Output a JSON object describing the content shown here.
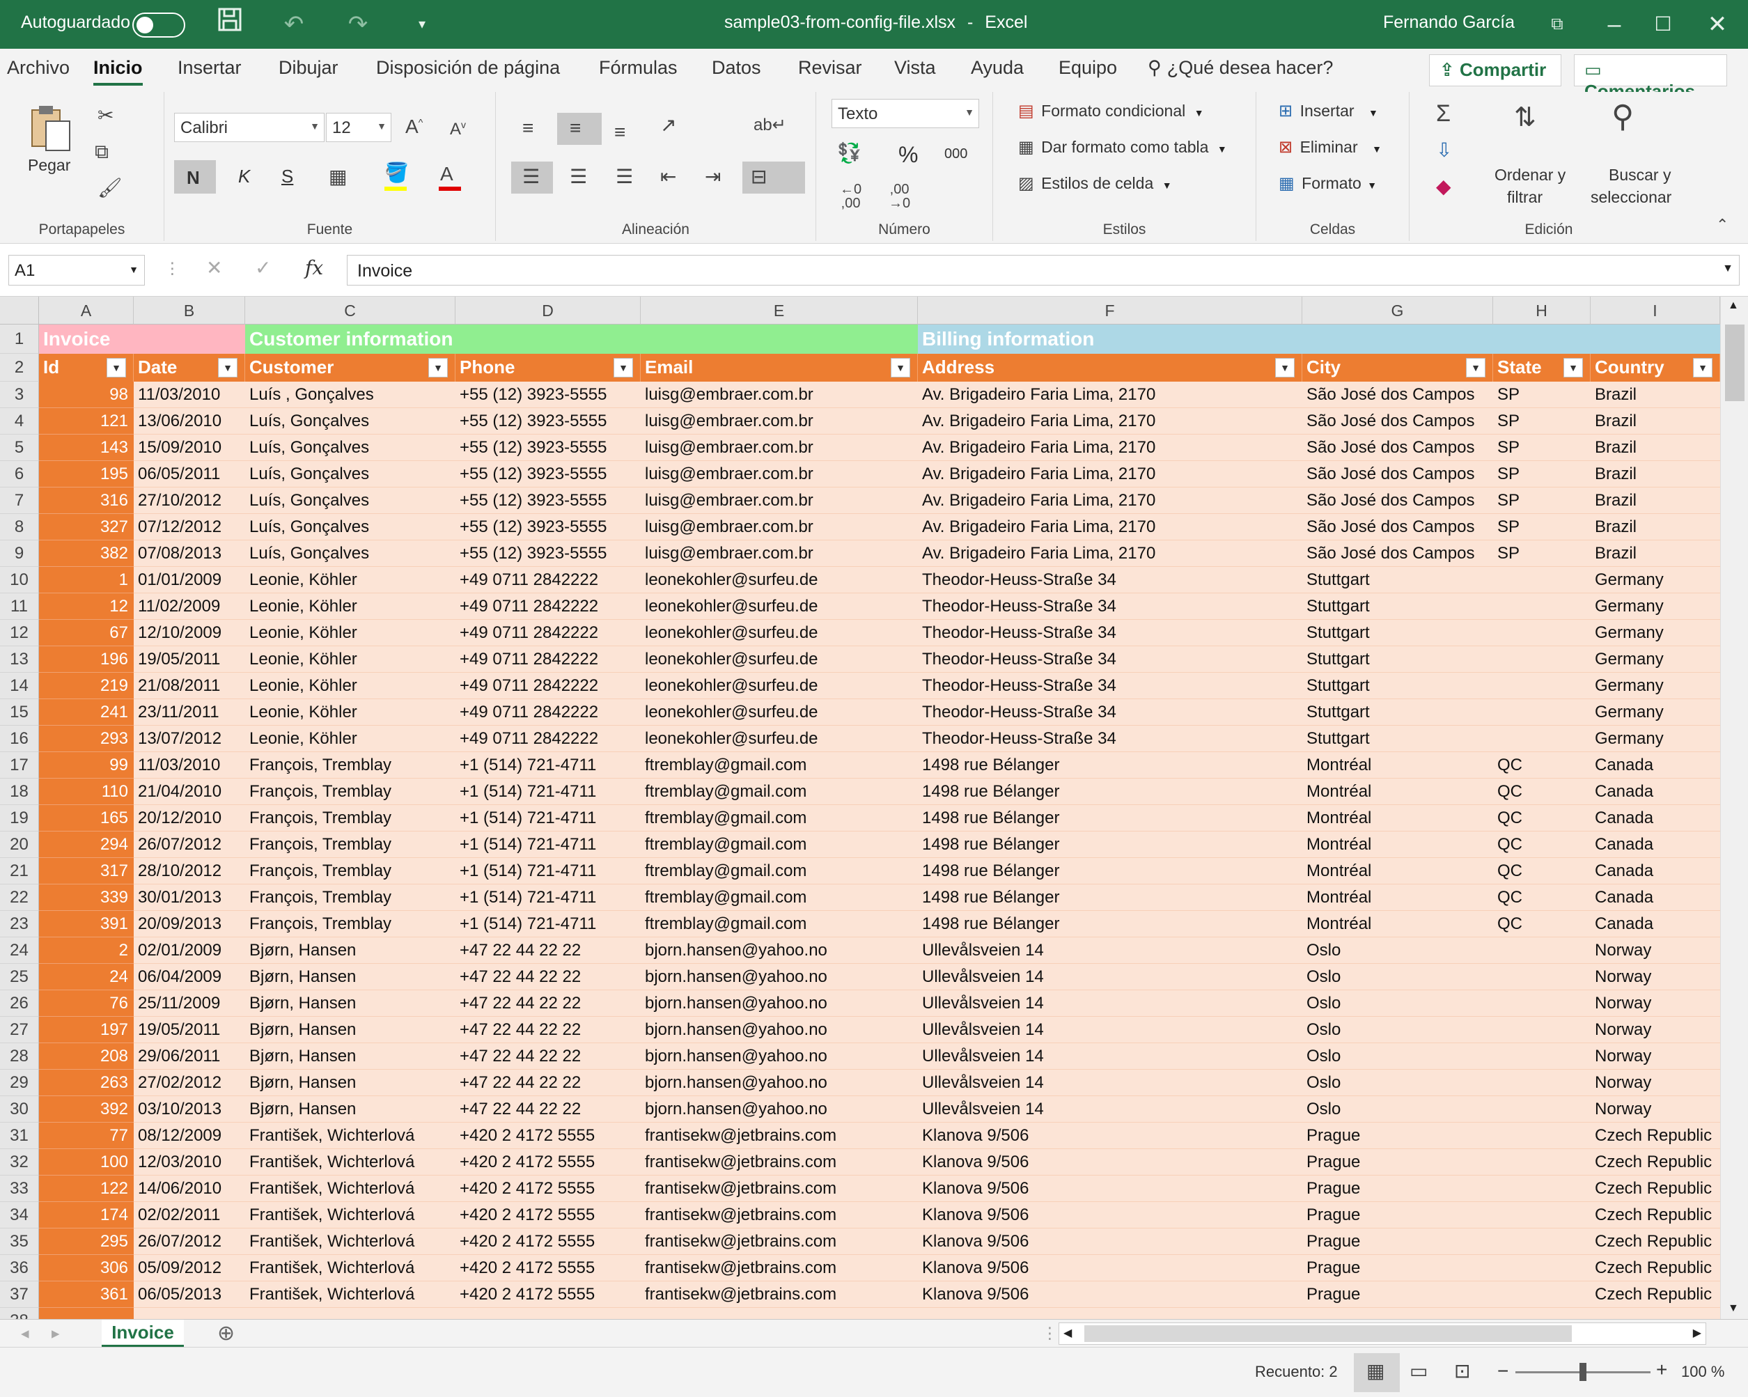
{
  "titlebar": {
    "autosave_label": "Autoguardado",
    "filename": "sample03-from-config-file.xlsx",
    "app_sep": "-",
    "app_name": "Excel",
    "user": "Fernando García"
  },
  "menu": {
    "tabs": [
      "Archivo",
      "Inicio",
      "Insertar",
      "Dibujar",
      "Disposición de página",
      "Fórmulas",
      "Datos",
      "Revisar",
      "Vista",
      "Ayuda",
      "Equipo"
    ],
    "active_tab": "Inicio",
    "tell_me": "¿Qué desea hacer?",
    "share": "Compartir",
    "comments": "Comentarios"
  },
  "ribbon": {
    "clipboard": {
      "paste": "Pegar",
      "label": "Portapapeles"
    },
    "font": {
      "family": "Calibri",
      "size": "12",
      "bold": "N",
      "italic": "K",
      "underline": "S",
      "label": "Fuente"
    },
    "alignment": {
      "label": "Alineación"
    },
    "number": {
      "format": "Texto",
      "percent": "%",
      "thousands": "000",
      "label": "Número"
    },
    "styles": {
      "conditional": "Formato condicional",
      "as_table": "Dar formato como tabla",
      "cell_styles": "Estilos de celda",
      "label": "Estilos"
    },
    "cells": {
      "insert": "Insertar",
      "delete": "Eliminar",
      "format": "Formato",
      "label": "Celdas"
    },
    "editing": {
      "sort_l1": "Ordenar y",
      "sort_l2": "filtrar",
      "find_l1": "Buscar y",
      "find_l2": "seleccionar",
      "label": "Edición"
    }
  },
  "formula_bar": {
    "name_box": "A1",
    "fx": "fx",
    "value": "Invoice"
  },
  "columns": [
    "A",
    "B",
    "C",
    "D",
    "E",
    "F",
    "G",
    "H",
    "I"
  ],
  "group_headers": {
    "invoice": "Invoice",
    "customer": "Customer information",
    "billing": "Billing information"
  },
  "table_headers": [
    "Id",
    "Date",
    "Customer",
    "Phone",
    "Email",
    "Address",
    "City",
    "State",
    "Country"
  ],
  "rows": [
    [
      "98",
      "11/03/2010",
      "  Luís  , Gonçalves",
      "+55 (12) 3923-5555",
      "luisg@embraer.com.br",
      "Av. Brigadeiro Faria Lima, 2170",
      "São José dos Campos",
      "SP",
      "Brazil"
    ],
    [
      "121",
      "13/06/2010",
      "Luís, Gonçalves",
      "+55 (12) 3923-5555",
      "luisg@embraer.com.br",
      "Av. Brigadeiro Faria Lima, 2170",
      "São José dos Campos",
      "SP",
      "Brazil"
    ],
    [
      "143",
      "15/09/2010",
      "Luís, Gonçalves",
      "+55 (12) 3923-5555",
      "luisg@embraer.com.br",
      "Av. Brigadeiro Faria Lima, 2170",
      "São José dos Campos",
      "SP",
      "Brazil"
    ],
    [
      "195",
      "06/05/2011",
      "Luís, Gonçalves",
      "+55 (12) 3923-5555",
      "luisg@embraer.com.br",
      "Av. Brigadeiro Faria Lima, 2170",
      "São José dos Campos",
      "SP",
      "Brazil"
    ],
    [
      "316",
      "27/10/2012",
      "Luís, Gonçalves",
      "+55 (12) 3923-5555",
      "luisg@embraer.com.br",
      "Av. Brigadeiro Faria Lima, 2170",
      "São José dos Campos",
      "SP",
      "Brazil"
    ],
    [
      "327",
      "07/12/2012",
      "Luís, Gonçalves",
      "+55 (12) 3923-5555",
      "luisg@embraer.com.br",
      "Av. Brigadeiro Faria Lima, 2170",
      "São José dos Campos",
      "SP",
      "Brazil"
    ],
    [
      "382",
      "07/08/2013",
      "Luís, Gonçalves",
      "+55 (12) 3923-5555",
      "luisg@embraer.com.br",
      "Av. Brigadeiro Faria Lima, 2170",
      "São José dos Campos",
      "SP",
      "Brazil"
    ],
    [
      "1",
      "01/01/2009",
      "Leonie, Köhler",
      "+49 0711 2842222",
      "leonekohler@surfeu.de",
      "Theodor-Heuss-Straße 34",
      "Stuttgart",
      "",
      "Germany"
    ],
    [
      "12",
      "11/02/2009",
      "Leonie, Köhler",
      "+49 0711 2842222",
      "leonekohler@surfeu.de",
      "Theodor-Heuss-Straße 34",
      "Stuttgart",
      "",
      "Germany"
    ],
    [
      "67",
      "12/10/2009",
      "Leonie, Köhler",
      "+49 0711 2842222",
      "leonekohler@surfeu.de",
      "Theodor-Heuss-Straße 34",
      "Stuttgart",
      "",
      "Germany"
    ],
    [
      "196",
      "19/05/2011",
      "Leonie, Köhler",
      "+49 0711 2842222",
      "leonekohler@surfeu.de",
      "Theodor-Heuss-Straße 34",
      "Stuttgart",
      "",
      "Germany"
    ],
    [
      "219",
      "21/08/2011",
      "Leonie, Köhler",
      "+49 0711 2842222",
      "leonekohler@surfeu.de",
      "Theodor-Heuss-Straße 34",
      "Stuttgart",
      "",
      "Germany"
    ],
    [
      "241",
      "23/11/2011",
      "Leonie, Köhler",
      "+49 0711 2842222",
      "leonekohler@surfeu.de",
      "Theodor-Heuss-Straße 34",
      "Stuttgart",
      "",
      "Germany"
    ],
    [
      "293",
      "13/07/2012",
      "Leonie, Köhler",
      "+49 0711 2842222",
      "leonekohler@surfeu.de",
      "Theodor-Heuss-Straße 34",
      "Stuttgart",
      "",
      "Germany"
    ],
    [
      "99",
      "11/03/2010",
      "François, Tremblay",
      "+1 (514) 721-4711",
      "ftremblay@gmail.com",
      "1498 rue Bélanger",
      "Montréal",
      "QC",
      "Canada"
    ],
    [
      "110",
      "21/04/2010",
      "François, Tremblay",
      "+1 (514) 721-4711",
      "ftremblay@gmail.com",
      "1498 rue Bélanger",
      "Montréal",
      "QC",
      "Canada"
    ],
    [
      "165",
      "20/12/2010",
      "François, Tremblay",
      "+1 (514) 721-4711",
      "ftremblay@gmail.com",
      "1498 rue Bélanger",
      "Montréal",
      "QC",
      "Canada"
    ],
    [
      "294",
      "26/07/2012",
      "François, Tremblay",
      "+1 (514) 721-4711",
      "ftremblay@gmail.com",
      "1498 rue Bélanger",
      "Montréal",
      "QC",
      "Canada"
    ],
    [
      "317",
      "28/10/2012",
      "François, Tremblay",
      "+1 (514) 721-4711",
      "ftremblay@gmail.com",
      "1498 rue Bélanger",
      "Montréal",
      "QC",
      "Canada"
    ],
    [
      "339",
      "30/01/2013",
      "François, Tremblay",
      "+1 (514) 721-4711",
      "ftremblay@gmail.com",
      "1498 rue Bélanger",
      "Montréal",
      "QC",
      "Canada"
    ],
    [
      "391",
      "20/09/2013",
      "François, Tremblay",
      "+1 (514) 721-4711",
      "ftremblay@gmail.com",
      "1498 rue Bélanger",
      "Montréal",
      "QC",
      "Canada"
    ],
    [
      "2",
      "02/01/2009",
      "Bjørn, Hansen",
      "+47 22 44 22 22",
      "bjorn.hansen@yahoo.no",
      "Ullevålsveien 14",
      "Oslo",
      "",
      "Norway"
    ],
    [
      "24",
      "06/04/2009",
      "Bjørn, Hansen",
      "+47 22 44 22 22",
      "bjorn.hansen@yahoo.no",
      "Ullevålsveien 14",
      "Oslo",
      "",
      "Norway"
    ],
    [
      "76",
      "25/11/2009",
      "Bjørn, Hansen",
      "+47 22 44 22 22",
      "bjorn.hansen@yahoo.no",
      "Ullevålsveien 14",
      "Oslo",
      "",
      "Norway"
    ],
    [
      "197",
      "19/05/2011",
      "Bjørn, Hansen",
      "+47 22 44 22 22",
      "bjorn.hansen@yahoo.no",
      "Ullevålsveien 14",
      "Oslo",
      "",
      "Norway"
    ],
    [
      "208",
      "29/06/2011",
      "Bjørn, Hansen",
      "+47 22 44 22 22",
      "bjorn.hansen@yahoo.no",
      "Ullevålsveien 14",
      "Oslo",
      "",
      "Norway"
    ],
    [
      "263",
      "27/02/2012",
      "Bjørn, Hansen",
      "+47 22 44 22 22",
      "bjorn.hansen@yahoo.no",
      "Ullevålsveien 14",
      "Oslo",
      "",
      "Norway"
    ],
    [
      "392",
      "03/10/2013",
      "Bjørn, Hansen",
      "+47 22 44 22 22",
      "bjorn.hansen@yahoo.no",
      "Ullevålsveien 14",
      "Oslo",
      "",
      "Norway"
    ],
    [
      "77",
      "08/12/2009",
      "František, Wichterlová",
      "+420 2 4172 5555",
      "frantisekw@jetbrains.com",
      "Klanova 9/506",
      "Prague",
      "",
      "Czech Republic"
    ],
    [
      "100",
      "12/03/2010",
      "František, Wichterlová",
      "+420 2 4172 5555",
      "frantisekw@jetbrains.com",
      "Klanova 9/506",
      "Prague",
      "",
      "Czech Republic"
    ],
    [
      "122",
      "14/06/2010",
      "František, Wichterlová",
      "+420 2 4172 5555",
      "frantisekw@jetbrains.com",
      "Klanova 9/506",
      "Prague",
      "",
      "Czech Republic"
    ],
    [
      "174",
      "02/02/2011",
      "František, Wichterlová",
      "+420 2 4172 5555",
      "frantisekw@jetbrains.com",
      "Klanova 9/506",
      "Prague",
      "",
      "Czech Republic"
    ],
    [
      "295",
      "26/07/2012",
      "František, Wichterlová",
      "+420 2 4172 5555",
      "frantisekw@jetbrains.com",
      "Klanova 9/506",
      "Prague",
      "",
      "Czech Republic"
    ],
    [
      "306",
      "05/09/2012",
      "František, Wichterlová",
      "+420 2 4172 5555",
      "frantisekw@jetbrains.com",
      "Klanova 9/506",
      "Prague",
      "",
      "Czech Republic"
    ],
    [
      "361",
      "06/05/2013",
      "František, Wichterlová",
      "+420 2 4172 5555",
      "frantisekw@jetbrains.com",
      "Klanova 9/506",
      "Prague",
      "",
      "Czech Republic"
    ]
  ],
  "sheet_tab": "Invoice",
  "status": {
    "count": "Recuento: 2",
    "zoom": "100 %",
    "zoom_minus": "−",
    "zoom_plus": "+"
  },
  "colors": {
    "title_green": "#217346",
    "orange": "#ed7d31",
    "peach": "#fce4d6",
    "pink": "#ffb6c1",
    "light_green": "#90ee90",
    "light_blue": "#add8e6"
  }
}
